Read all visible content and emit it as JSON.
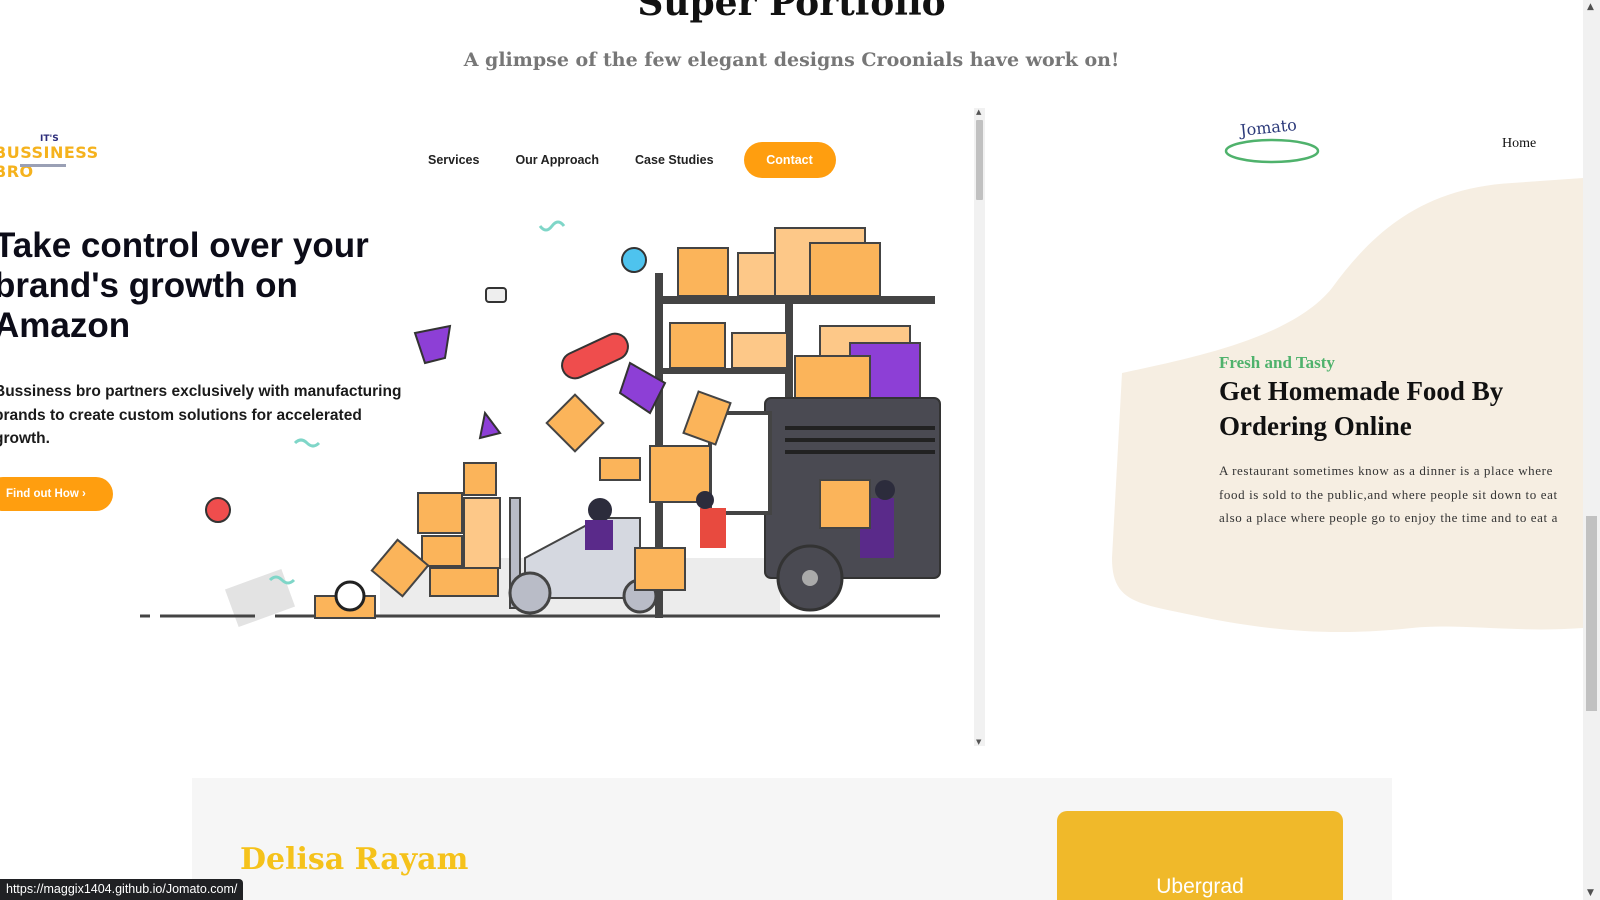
{
  "section": {
    "title": "Super Portfolio",
    "subtitle": "A glimpse of the few elegant designs Croonials have work on!"
  },
  "business_bro": {
    "logo_small": "IT'S",
    "logo_name": "BUSSINESS BRO",
    "nav": [
      "Services",
      "Our Approach",
      "Case Studies"
    ],
    "contact_label": "Contact",
    "headline_lines": [
      "Take control over your",
      "brand's growth on",
      "Amazon"
    ],
    "description_lines": [
      "Bussiness bro partners exclusively with manufacturing",
      "brands to create custom solutions for accelerated",
      "growth."
    ],
    "cta_label": "Find out How ›",
    "accent": "#ff9e0f"
  },
  "jomato": {
    "logo": "Jomato",
    "nav_home": "Home",
    "tagline": "Fresh and Tasty",
    "title_lines": [
      "Get Homemade Food By",
      "Ordering Online"
    ],
    "description_lines": [
      "A restaurant sometimes know as a dinner is a place where",
      "food is sold to the public,and where people sit down to eat",
      "also a place where people go to enjoy the time and to eat a"
    ],
    "accent": "#4fb26c"
  },
  "testimonial": {
    "name": "Delisa Rayam",
    "card_label": "Ubergrad",
    "name_color": "#f5c21b"
  },
  "status_bar": {
    "url": "https://maggix1404.github.io/Jomato.com/"
  }
}
